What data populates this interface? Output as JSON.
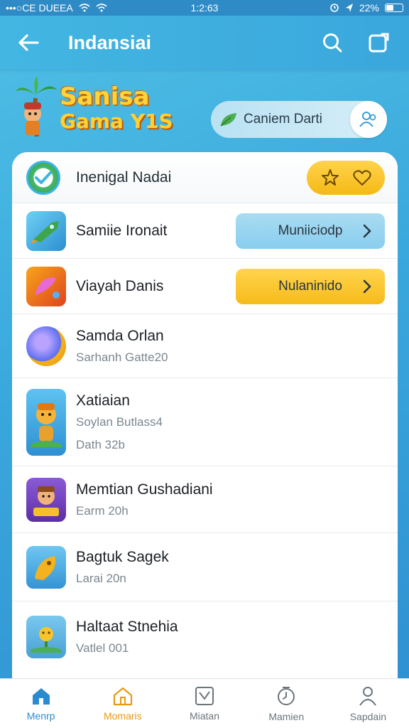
{
  "status_bar": {
    "carrier": "•••○CE DUEEA",
    "time": "1:2:63",
    "battery": "22%"
  },
  "app_bar": {
    "title": "Indansiai"
  },
  "hero": {
    "logo_line1": "Sanisa",
    "logo_line2": "Gama Y1S",
    "pill_label": "Caniem Darti"
  },
  "card_header": {
    "title": "Inenigal Nadai"
  },
  "list": [
    {
      "name": "Samiie Ironait",
      "subtitle": "",
      "subtitle2": "",
      "action": "Muniiciodp",
      "action_style": "blue"
    },
    {
      "name": "Viayah Danis",
      "subtitle": "",
      "subtitle2": "",
      "action": "Nulaninido",
      "action_style": "yellow"
    },
    {
      "name": "Samda Orlan",
      "subtitle": "Sarhanh Gatte20",
      "subtitle2": "",
      "action": "",
      "action_style": ""
    },
    {
      "name": "Xatiaian",
      "subtitle": "Soylan Butlass4",
      "subtitle2": "Dath 32b",
      "action": "",
      "action_style": ""
    },
    {
      "name": "Memtian Gushadiani",
      "subtitle": "Earm 20h",
      "subtitle2": "",
      "action": "",
      "action_style": ""
    },
    {
      "name": "Bagtuk Sagek",
      "subtitle": "Larai 20n",
      "subtitle2": "",
      "action": "",
      "action_style": ""
    },
    {
      "name": "Haltaat Stnehia",
      "subtitle": "Vatlel 001",
      "subtitle2": "",
      "action": "",
      "action_style": ""
    }
  ],
  "tabs": [
    {
      "label": "Menrp",
      "icon": "home-icon"
    },
    {
      "label": "Momaris",
      "icon": "house-outline-icon"
    },
    {
      "label": "Miatan",
      "icon": "map-icon"
    },
    {
      "label": "Mamien",
      "icon": "clock-icon"
    },
    {
      "label": "Sapdain",
      "icon": "person-icon"
    }
  ],
  "colors": {
    "background": "#3aa8dc",
    "accent_blue": "#2a8bd0",
    "accent_yellow": "#f6bb1a",
    "tab_orange": "#e89a12"
  }
}
